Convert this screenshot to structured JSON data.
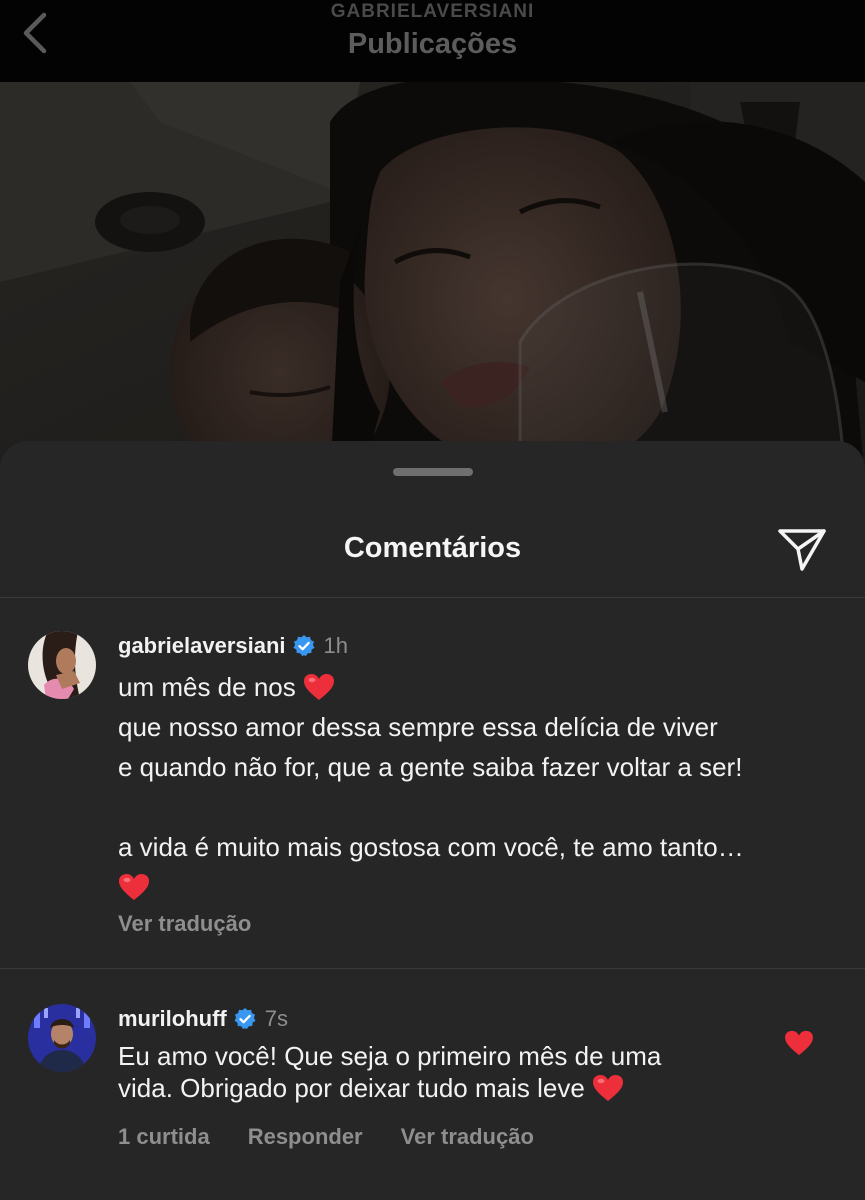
{
  "header": {
    "username": "GABRIELAVERSIANI",
    "title": "Publicações"
  },
  "sheet": {
    "title": "Comentários"
  },
  "comments": [
    {
      "username": "gabrielaversiani",
      "verified": true,
      "time": "1h",
      "lines": [
        "um mês de nos",
        "que nosso amor dessa sempre essa delícia de viver",
        "e quando não for, que a gente saiba fazer voltar a ser!",
        "",
        "a vida é muito mais gostosa com você, te amo tanto…",
        ""
      ],
      "translate_label": "Ver tradução"
    },
    {
      "username": "murilohuff",
      "verified": true,
      "time": "7s",
      "lines": [
        "Eu amo você! Que seja o primeiro mês de uma",
        "vida. Obrigado por deixar tudo mais leve"
      ],
      "likes_label": "1 curtida",
      "reply_label": "Responder",
      "translate_label": "Ver tradução",
      "liked": true
    }
  ],
  "colors": {
    "sheet_bg": "#262626",
    "verified_blue": "#3897f0",
    "heart_red": "#ed4956",
    "muted_text": "#8e8e8e"
  },
  "icons": [
    "back-chevron-icon",
    "share-icon",
    "verified-badge-icon",
    "heart-emoji-icon",
    "like-heart-icon"
  ]
}
